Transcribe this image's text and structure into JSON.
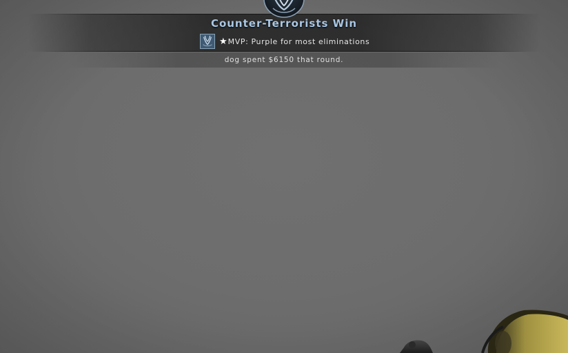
{
  "round_end": {
    "title": "Counter-Terrorists Win",
    "mvp": {
      "star": "★",
      "text": "MVP: Purple for most eliminations"
    },
    "money_message": "dog spent $6150 that round."
  },
  "colors": {
    "title_color": "#a9c8e6",
    "background": "#6b6b6b",
    "banner": "#2a2a2a"
  },
  "icons": {
    "team_emblem": "counter-terrorist-emblem-icon",
    "mvp_avatar": "player-avatar-icon",
    "mvp_star": "star-icon"
  }
}
